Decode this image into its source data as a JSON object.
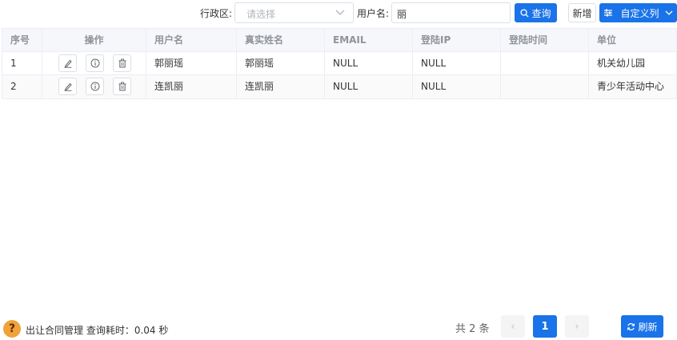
{
  "filters": {
    "district_label": "行政区:",
    "district_placeholder": "请选择",
    "username_label": "用户名:",
    "username_value": "丽"
  },
  "toolbar": {
    "query_label": "查询",
    "add_label": "新增",
    "custom_columns_label": "自定义列"
  },
  "table": {
    "columns": [
      "序号",
      "操作",
      "用户名",
      "真实姓名",
      "EMAIL",
      "登陆IP",
      "登陆时间",
      "单位"
    ],
    "rows": [
      {
        "index": "1",
        "username": "郭丽瑶",
        "real_name": "郭丽瑶",
        "email": "NULL",
        "login_ip": "NULL",
        "login_time": "",
        "unit": "机关幼儿园"
      },
      {
        "index": "2",
        "username": "连凯丽",
        "real_name": "连凯丽",
        "email": "NULL",
        "login_ip": "NULL",
        "login_time": "",
        "unit": "青少年活动中心"
      }
    ]
  },
  "footer": {
    "help_glyph": "?",
    "status_text": "出让合同管理 查询耗时：0.04 秒",
    "total_text": "共 2 条",
    "current_page": "1",
    "prev_glyph": "‹",
    "next_glyph": "›",
    "refresh_label": "刷新"
  },
  "colors": {
    "primary": "#1a73e8",
    "help_badge": "#f0a33a"
  }
}
